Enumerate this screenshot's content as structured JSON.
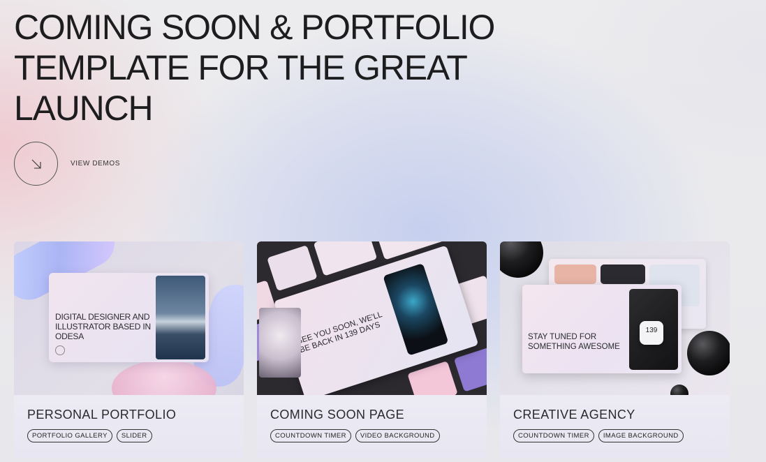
{
  "hero": {
    "title": "COMING SOON & PORTFOLIO TEMPLATE FOR THE GREAT LAUNCH",
    "cta_label": "VIEW DEMOS"
  },
  "cards": [
    {
      "title": "PERSONAL PORTFOLIO",
      "tags": [
        "PORTFOLIO GALLERY",
        "SLIDER"
      ],
      "preview_text": "DIGITAL DESIGNER AND ILLUSTRATOR BASED IN ODESA"
    },
    {
      "title": "COMING SOON PAGE",
      "tags": [
        "COUNTDOWN TIMER",
        "VIDEO BACKGROUND"
      ],
      "preview_text": "SEE YOU SOON, WE'LL BE BACK IN 139 DAYS"
    },
    {
      "title": "CREATIVE AGENCY",
      "tags": [
        "COUNTDOWN TIMER",
        "IMAGE BACKGROUND"
      ],
      "preview_text": "STAY TUNED FOR SOMETHING AWESOME",
      "badge": "139"
    }
  ],
  "icons": {
    "cta": "arrow-down-right-icon"
  },
  "colors": {
    "text": "#1d1d1f",
    "tag_border": "#333333"
  }
}
